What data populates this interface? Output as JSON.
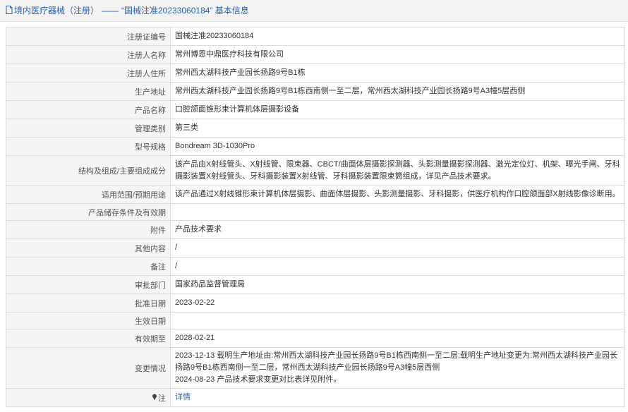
{
  "header": {
    "section": "境内医疗器械（注册）",
    "sep": "——",
    "title": "“国械注准20233060184” 基本信息"
  },
  "rows": [
    {
      "label": "注册证编号",
      "value": "国械注准20233060184"
    },
    {
      "label": "注册人名称",
      "value": "常州博恩中鼎医疗科技有限公司"
    },
    {
      "label": "注册人住所",
      "value": "常州西太湖科技产业园长扬路9号B1栋"
    },
    {
      "label": "生产地址",
      "value": "常州西太湖科技产业园长扬路9号B1栋西南侧一至二层，常州西太湖科技产业园长扬路9号A3幢5层西侧"
    },
    {
      "label": "产品名称",
      "value": "口腔颌面锥形束计算机体层摄影设备"
    },
    {
      "label": "管理类别",
      "value": "第三类"
    },
    {
      "label": "型号规格",
      "value": "Bondream 3D-1030Pro"
    },
    {
      "label": "结构及组成/主要组成成分",
      "value": "该产品由X射线管头、X射线管、限束器、CBCT/曲面体层摄影探测器、头影测量摄影探测器、激光定位灯、机架、曝光手闸、牙科摄影装置X射线管头、牙科摄影装置X射线管、牙科摄影装置限束筒组成，详见产品技术要求。"
    },
    {
      "label": "适用范围/预期用途",
      "value": "该产品通过X射线锥形束计算机体层摄影、曲面体层摄影、头影测量摄影、牙科摄影，供医疗机构作口腔颌面部X射线影像诊断用。"
    },
    {
      "label": "产品储存条件及有效期",
      "value": ""
    },
    {
      "label": "附件",
      "value": "产品技术要求"
    },
    {
      "label": "其他内容",
      "value": "/"
    },
    {
      "label": "备注",
      "value": "/"
    },
    {
      "label": "审批部门",
      "value": "国家药品监督管理局"
    },
    {
      "label": "批准日期",
      "value": "2023-02-22"
    },
    {
      "label": "生效日期",
      "value": ""
    },
    {
      "label": "有效期至",
      "value": "2028-02-21"
    }
  ],
  "change": {
    "label": "变更情况",
    "line1": "2023-12-13 载明生产地址由:常州西太湖科技产业园长扬路9号B1栋西南侧一至二层;载明生产地址变更为:常州西太湖科技产业园长扬路9号B1栋西南侧一至二层，常州西太湖科技产业园长扬路9号A3幢5层西侧",
    "line2": "2024-08-23 产品技术要求变更对比表详见附件。"
  },
  "note": {
    "label": "注",
    "link": "详情"
  },
  "colors": {
    "accent": "#2a62b0",
    "label_bg": "#f5f5f5",
    "border": "#dcdcdc"
  },
  "icons": [
    "document-icon",
    "pin-icon"
  ]
}
